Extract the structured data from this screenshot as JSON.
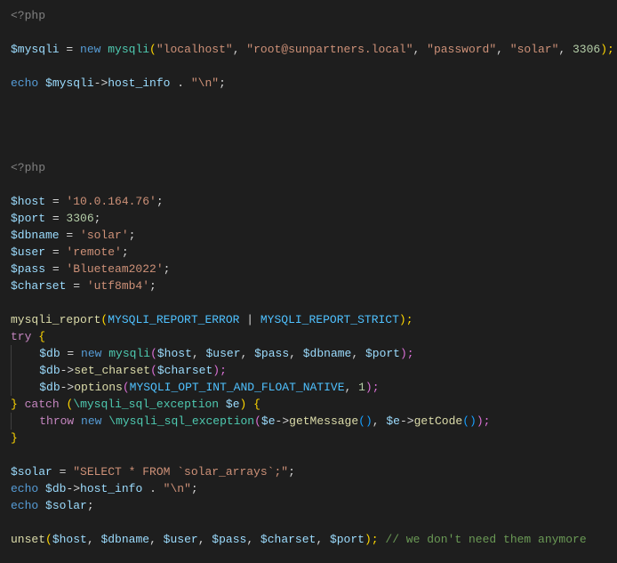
{
  "code": {
    "l1_open": "<?php",
    "l3_var": "$mysqli",
    "l3_eq": " = ",
    "l3_new": "new",
    "l3_sp": " ",
    "l3_class": "mysqli",
    "l3_p1": "(",
    "l3_s1": "\"localhost\"",
    "l3_c1": ", ",
    "l3_s2": "\"root@sunpartners.local\"",
    "l3_c2": ", ",
    "l3_s3": "\"password\"",
    "l3_c3": ", ",
    "l3_s4": "\"solar\"",
    "l3_c4": ", ",
    "l3_n1": "3306",
    "l3_p2": ");",
    "l5_echo": "echo",
    "l5_sp": " ",
    "l5_var": "$mysqli",
    "l5_arrow": "->",
    "l5_prop": "host_info",
    "l5_cat": " . ",
    "l5_str": "\"\\n\"",
    "l5_end": ";",
    "l10_open": "<?php",
    "l12_var": "$host",
    "l12_eq": " = ",
    "l12_str": "'10.0.164.76'",
    "l12_end": ";",
    "l13_var": "$port",
    "l13_eq": " = ",
    "l13_num": "3306",
    "l13_end": ";",
    "l14_var": "$dbname",
    "l14_eq": " = ",
    "l14_str": "'solar'",
    "l14_end": ";",
    "l15_var": "$user",
    "l15_eq": " = ",
    "l15_str": "'remote'",
    "l15_end": ";",
    "l16_var": "$pass",
    "l16_eq": " = ",
    "l16_str": "'Blueteam2022'",
    "l16_end": ";",
    "l17_var": "$charset",
    "l17_eq": " = ",
    "l17_str": "'utf8mb4'",
    "l17_end": ";",
    "l19_fn": "mysqli_report",
    "l19_p1": "(",
    "l19_c1": "MYSQLI_REPORT_ERROR",
    "l19_op": " | ",
    "l19_c2": "MYSQLI_REPORT_STRICT",
    "l19_p2": ");",
    "l20_try": "try",
    "l20_sp": " ",
    "l20_br": "{",
    "l21_ind": "    ",
    "l21_var": "$db",
    "l21_eq": " = ",
    "l21_new": "new",
    "l21_sp": " ",
    "l21_class": "mysqli",
    "l21_p1": "(",
    "l21_v1": "$host",
    "l21_c1": ", ",
    "l21_v2": "$user",
    "l21_c2": ", ",
    "l21_v3": "$pass",
    "l21_c3": ", ",
    "l21_v4": "$dbname",
    "l21_c4": ", ",
    "l21_v5": "$port",
    "l21_p2": ");",
    "l22_ind": "    ",
    "l22_var": "$db",
    "l22_arrow": "->",
    "l22_fn": "set_charset",
    "l22_p1": "(",
    "l22_v1": "$charset",
    "l22_p2": ");",
    "l23_ind": "    ",
    "l23_var": "$db",
    "l23_arrow": "->",
    "l23_fn": "options",
    "l23_p1": "(",
    "l23_c1": "MYSQLI_OPT_INT_AND_FLOAT_NATIVE",
    "l23_c2": ", ",
    "l23_n1": "1",
    "l23_p2": ");",
    "l24_br1": "}",
    "l24_sp1": " ",
    "l24_catch": "catch",
    "l24_sp2": " ",
    "l24_p1": "(",
    "l24_ns": "\\",
    "l24_class": "mysqli_sql_exception",
    "l24_sp3": " ",
    "l24_var": "$e",
    "l24_p2": ")",
    "l24_sp4": " ",
    "l24_br2": "{",
    "l25_ind": "    ",
    "l25_throw": "throw",
    "l25_sp1": " ",
    "l25_new": "new",
    "l25_sp2": " ",
    "l25_ns": "\\",
    "l25_class": "mysqli_sql_exception",
    "l25_p1": "(",
    "l25_v1": "$e",
    "l25_arrow1": "->",
    "l25_fn1": "getMessage",
    "l25_pp1": "()",
    "l25_c1": ", ",
    "l25_v2": "$e",
    "l25_arrow2": "->",
    "l25_fn2": "getCode",
    "l25_pp2": "()",
    "l25_p2": ");",
    "l26_br": "}",
    "l28_var": "$solar",
    "l28_eq": " = ",
    "l28_str": "\"SELECT * FROM `solar_arrays`;\"",
    "l28_end": ";",
    "l29_echo": "echo",
    "l29_sp": " ",
    "l29_var": "$db",
    "l29_arrow": "->",
    "l29_prop": "host_info",
    "l29_cat": " . ",
    "l29_str": "\"\\n\"",
    "l29_end": ";",
    "l30_echo": "echo",
    "l30_sp": " ",
    "l30_var": "$solar",
    "l30_end": ";",
    "l32_fn": "unset",
    "l32_p1": "(",
    "l32_v1": "$host",
    "l32_c1": ", ",
    "l32_v2": "$dbname",
    "l32_c2": ", ",
    "l32_v3": "$user",
    "l32_c3": ", ",
    "l32_v4": "$pass",
    "l32_c4": ", ",
    "l32_v5": "$charset",
    "l32_c5": ", ",
    "l32_v6": "$port",
    "l32_p2": ");",
    "l32_sp": " ",
    "l32_comment": "// we don't need them anymore"
  }
}
